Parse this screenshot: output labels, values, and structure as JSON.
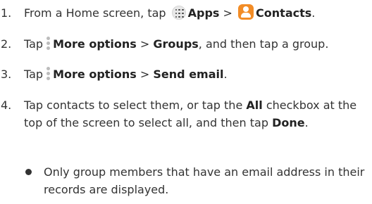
{
  "steps": [
    {
      "number": "1.",
      "parts": [
        "From a Home screen, tap",
        "Apps",
        ">",
        "Contacts",
        "."
      ]
    },
    {
      "number": "2.",
      "parts": [
        "Tap",
        "More options",
        ">",
        "Groups",
        ", and then tap a group."
      ]
    },
    {
      "number": "3.",
      "parts": [
        "Tap",
        "More options",
        ">",
        "Send email",
        "."
      ]
    },
    {
      "number": "4.",
      "parts": [
        "Tap contacts to select them, or tap the",
        "All",
        "checkbox at the top of the screen to select all, and then tap",
        "Done",
        "."
      ]
    }
  ],
  "bullet": "Only group members that have an email address in their records are displayed.",
  "icons": {
    "apps": "apps-grid-icon",
    "contacts": "contacts-icon",
    "more_options": "more-options-kebab-icon"
  },
  "colors": {
    "contacts_icon": "#f28c26",
    "text": "#333333"
  }
}
